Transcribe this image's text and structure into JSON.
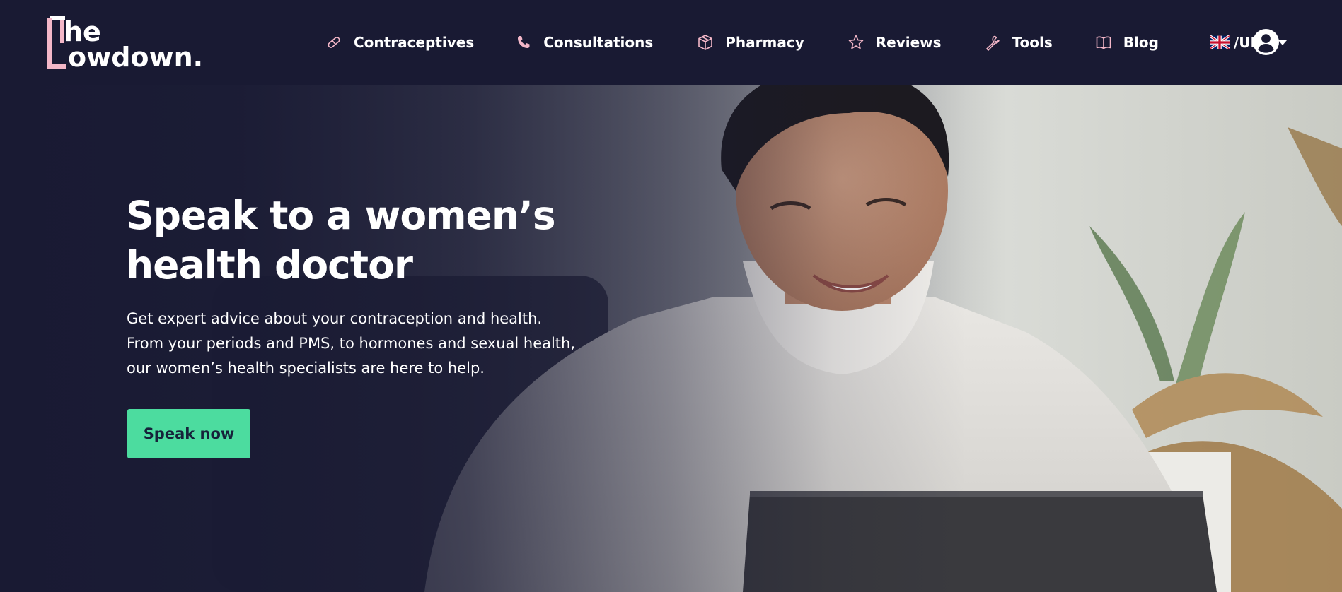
{
  "brand": {
    "logo_line1": "he",
    "logo_line2": "owdown.",
    "logo_alt": "The Lowdown.",
    "accent_color": "#f3b7c8"
  },
  "nav": {
    "items": [
      {
        "label": "Contraceptives",
        "icon": "pill-icon"
      },
      {
        "label": "Consultations",
        "icon": "phone-icon"
      },
      {
        "label": "Pharmacy",
        "icon": "box-icon"
      },
      {
        "label": "Reviews",
        "icon": "star-icon"
      },
      {
        "label": "Tools",
        "icon": "wrench-icon"
      },
      {
        "label": "Blog",
        "icon": "book-icon"
      }
    ],
    "locale": {
      "label": "/UK",
      "icon": "uk-flag-icon"
    },
    "account_icon": "user-icon"
  },
  "hero": {
    "title_line1": "Speak to a women’s",
    "title_line2": "health doctor",
    "subtitle_lines": [
      "Get expert advice about your contraception and health.",
      "From your periods and PMS, to hormones and sexual health,",
      "our women’s health specialists are here to help."
    ],
    "cta_label": "Speak now",
    "cta_color": "#4cdc9f"
  },
  "colors": {
    "header_bg": "#191a33",
    "icon_pink": "#f3b7c8",
    "text": "#ffffff"
  }
}
